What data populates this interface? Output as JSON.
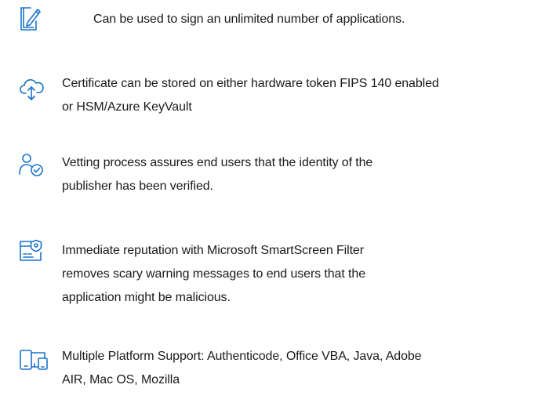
{
  "accent_color": "#1a73c8",
  "features": [
    {
      "icon": "sign-document-icon",
      "lines": [
        "Can be used to sign an unlimited number of applications."
      ]
    },
    {
      "icon": "cloud-upload-icon",
      "lines": [
        "Certificate can be stored on either hardware token FIPS 140  enabled",
        "or HSM/Azure KeyVault"
      ]
    },
    {
      "icon": "verified-user-icon",
      "lines": [
        "Vetting process assures end users that the identity of the",
        "publisher has been verified."
      ]
    },
    {
      "icon": "secure-browser-icon",
      "lines": [
        "Immediate reputation with Microsoft SmartScreen Filter",
        "removes scary warning messages to end users that the",
        "application might be malicious."
      ]
    },
    {
      "icon": "devices-icon",
      "lines": [
        "Multiple Platform Support: Authenticode, Office VBA, Java,  Adobe",
        "AIR, Mac OS, Mozilla"
      ]
    }
  ]
}
